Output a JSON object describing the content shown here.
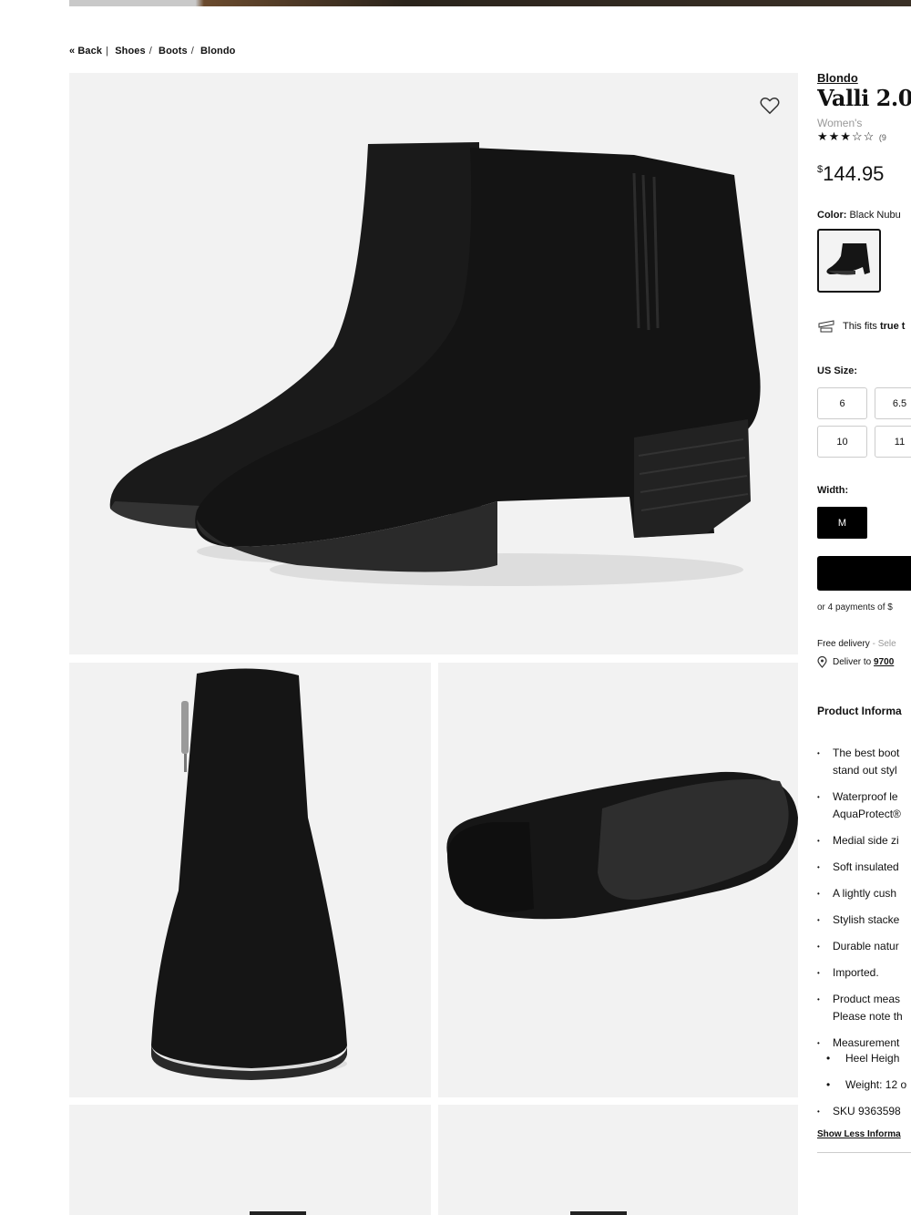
{
  "breadcrumb": {
    "back": "« Back",
    "items": [
      "Shoes",
      "Boots",
      "Blondo"
    ]
  },
  "product": {
    "brand": "Blondo",
    "title": "Valli 2.0",
    "gender": "Women's",
    "stars": "★★★☆☆",
    "rating_count": "(9",
    "rating": 3,
    "price_symbol": "$",
    "price": "144.95",
    "color_label": "Color:",
    "color_value": "Black Nubu",
    "fit_text": "This fits",
    "fit_bold": "true t",
    "size_label": "US Size:",
    "sizes": [
      "6",
      "6.5",
      "10",
      "11"
    ],
    "width_label": "Width:",
    "width_value": "M",
    "payments": "or 4 payments of $",
    "delivery": "Free delivery",
    "delivery_select": "- Sele",
    "deliver_to": "Deliver to",
    "zip": "9700",
    "info_title": "Product Informa",
    "bullets": [
      "The best boot",
      "stand out styl",
      "Waterproof le",
      "AquaProtect®",
      "Medial side zi",
      "Soft insulated",
      "A lightly cush",
      "Stylish stacke",
      "Durable natur",
      "Imported.",
      "Product meas",
      "Please note th",
      "Measurement",
      "Heel Heigh",
      "Weight: 12 o",
      "SKU 9363598"
    ],
    "show_less": "Show Less Informa"
  },
  "colors": {
    "accent": "#000000",
    "image_bg": "#f2f2f2",
    "muted": "#999999"
  }
}
